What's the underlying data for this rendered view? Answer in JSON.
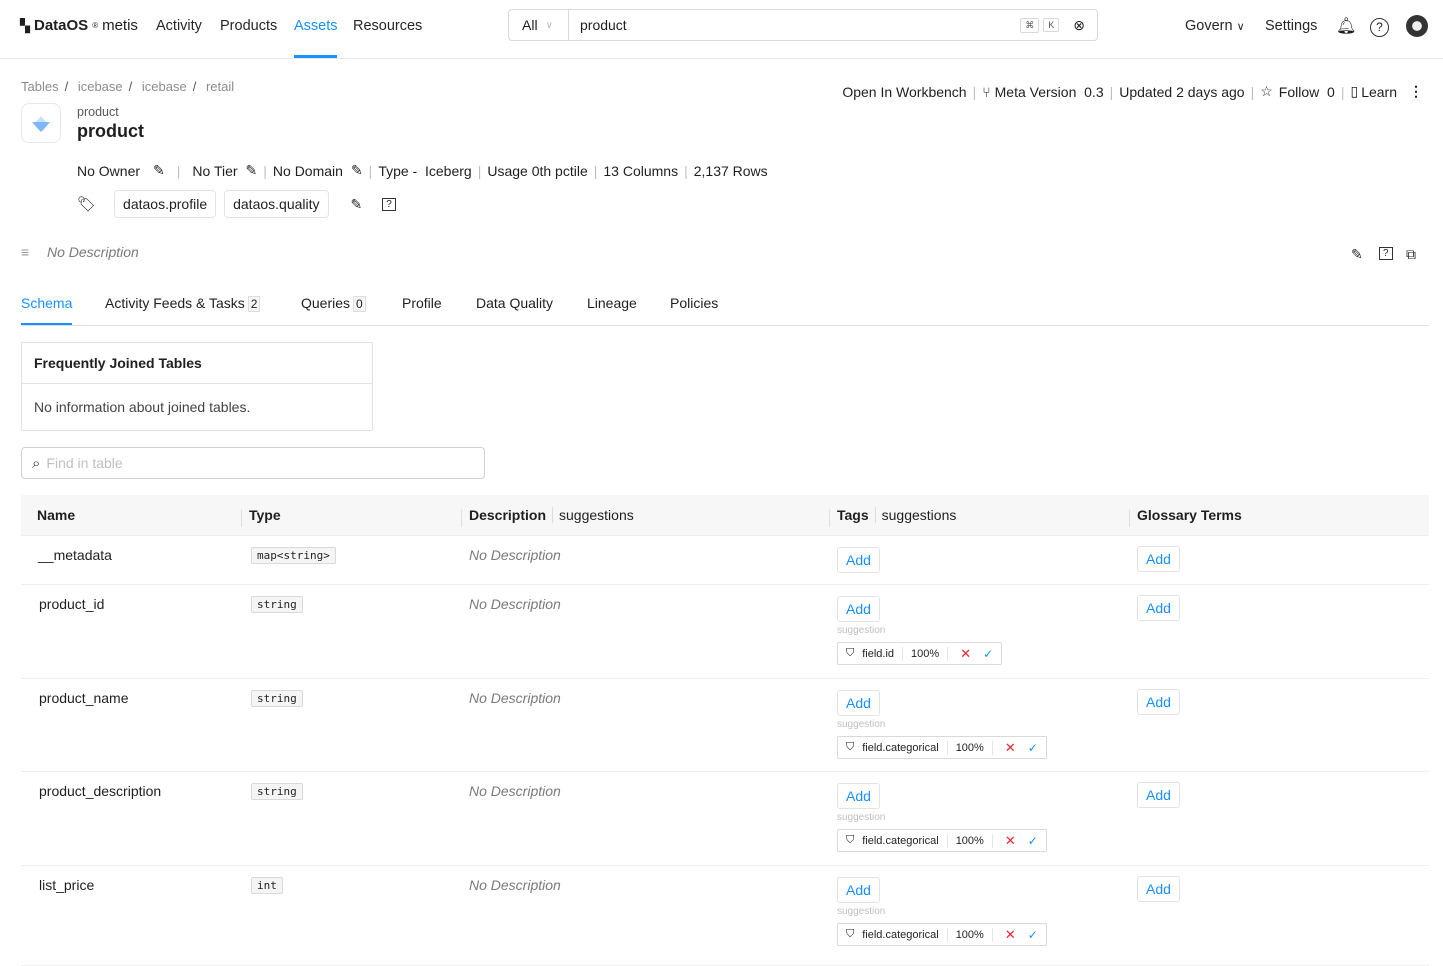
{
  "header": {
    "logo_brand": "DataOS",
    "logo_product": "metis",
    "nav": [
      "Activity",
      "Products",
      "Assets",
      "Resources"
    ],
    "active_nav": "Assets",
    "search_scope": "All",
    "search_value": "product",
    "kbd": [
      "⌘",
      "K"
    ],
    "govern": "Govern",
    "settings": "Settings"
  },
  "breadcrumb": [
    "Tables",
    "icebase",
    "icebase",
    "retail"
  ],
  "entity": {
    "subtitle": "product",
    "title": "product",
    "owner": "No Owner",
    "tier": "No Tier",
    "domain": "No Domain",
    "type": "Type -  Iceberg",
    "usage": "Usage 0th pctile",
    "columns": "13 Columns",
    "rows": "2,137 Rows",
    "tags": [
      "dataos.profile",
      "dataos.quality"
    ],
    "description": "No Description"
  },
  "actions": {
    "workbench": "Open In Workbench",
    "meta_version_label": "Meta Version",
    "meta_version": "0.3",
    "updated": "Updated 2 days ago",
    "follow": "Follow",
    "follow_count": "0",
    "learn": "Learn"
  },
  "tabs": [
    {
      "label": "Schema"
    },
    {
      "label": "Activity Feeds & Tasks",
      "count": "2"
    },
    {
      "label": "Queries",
      "count": "0"
    },
    {
      "label": "Profile"
    },
    {
      "label": "Data Quality"
    },
    {
      "label": "Lineage"
    },
    {
      "label": "Policies"
    }
  ],
  "joined": {
    "title": "Frequently Joined Tables",
    "empty": "No information about joined tables."
  },
  "find_placeholder": "Find in table",
  "table": {
    "headers": {
      "name": "Name",
      "type": "Type",
      "description": "Description",
      "desc_suggestions": "suggestions",
      "tags": "Tags",
      "tag_suggestions": "suggestions",
      "glossary": "Glossary Terms"
    },
    "add_label": "Add",
    "suggestion_label": "suggestion",
    "rows": [
      {
        "name": "__metadata",
        "type": "map<string>",
        "description": "No Description"
      },
      {
        "name": "product_id",
        "type": "string",
        "description": "No Description",
        "suggestion": {
          "tag": "field.id",
          "confidence": "100%"
        }
      },
      {
        "name": "product_name",
        "type": "string",
        "description": "No Description",
        "suggestion": {
          "tag": "field.categorical",
          "confidence": "100%"
        }
      },
      {
        "name": "product_description",
        "type": "string",
        "description": "No Description",
        "suggestion": {
          "tag": "field.categorical",
          "confidence": "100%"
        }
      },
      {
        "name": "list_price",
        "type": "int",
        "description": "No Description",
        "suggestion": {
          "tag": "field.categorical",
          "confidence": "100%"
        }
      }
    ]
  },
  "colors": {
    "accent": "#1890ff",
    "reject": "#f5222d"
  }
}
